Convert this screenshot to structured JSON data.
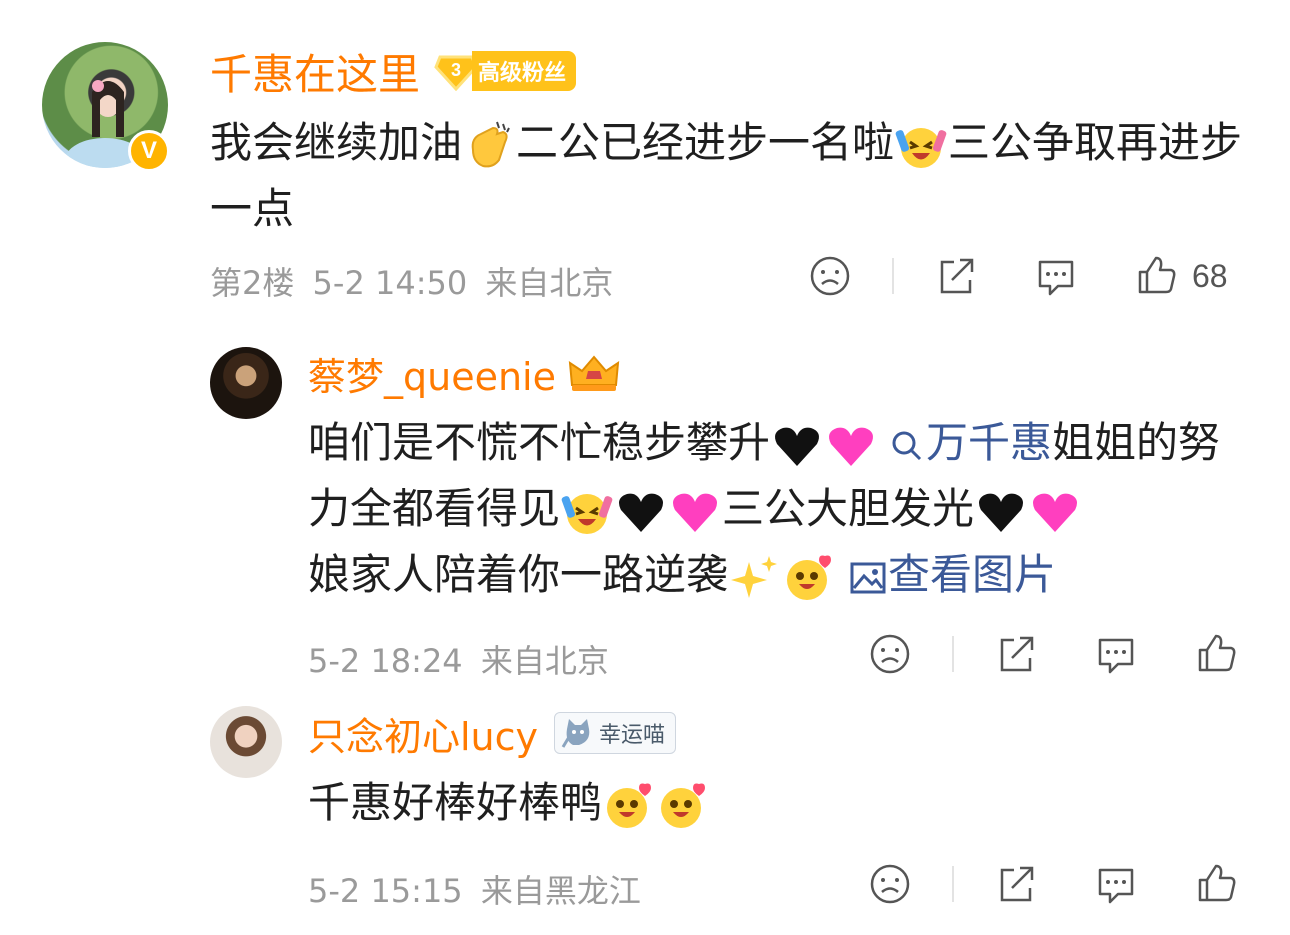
{
  "comments": [
    {
      "username": "千惠在这里",
      "badge": {
        "level": "3",
        "label": "高级粉丝"
      },
      "text_parts": [
        "我会继续加油",
        "二公已经进步一名啦",
        "三公争取再进步一点"
      ],
      "floor": "第2楼",
      "date": "5-2 14:50",
      "location": "来自北京",
      "like_count": "68"
    },
    {
      "username": "蔡梦_queenie",
      "text_parts": [
        "咱们是不慌不忙稳步攀升",
        "万千惠",
        "姐姐的努力全都看得见",
        "三公大胆发光",
        "娘家人陪着你一路逆袭"
      ],
      "view_image": "查看图片",
      "date": "5-2 18:24",
      "location": "来自北京"
    },
    {
      "username": "只念初心lucy",
      "badge": {
        "label": "幸运喵"
      },
      "text_parts": [
        "千惠好棒好棒鸭"
      ],
      "date": "5-2 15:15",
      "location": "来自黑龙江"
    }
  ],
  "colors": {
    "username": "#ff7a00",
    "meta": "#9a9a9a",
    "link": "#3b5998",
    "badge_gold": "#ffc21a"
  }
}
